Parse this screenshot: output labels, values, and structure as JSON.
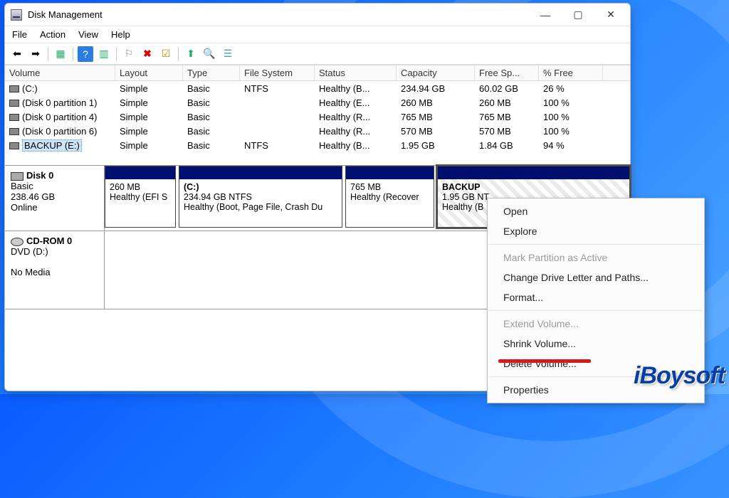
{
  "window": {
    "title": "Disk Management"
  },
  "menu": {
    "file": "File",
    "action": "Action",
    "view": "View",
    "help": "Help"
  },
  "columns": {
    "volume": "Volume",
    "layout": "Layout",
    "type": "Type",
    "filesystem": "File System",
    "status": "Status",
    "capacity": "Capacity",
    "freespace": "Free Sp...",
    "pctfree": "% Free"
  },
  "volumes": [
    {
      "name": "(C:)",
      "layout": "Simple",
      "type": "Basic",
      "fs": "NTFS",
      "status": "Healthy (B...",
      "capacity": "234.94 GB",
      "free": "60.02 GB",
      "pct": "26 %"
    },
    {
      "name": "(Disk 0 partition 1)",
      "layout": "Simple",
      "type": "Basic",
      "fs": "",
      "status": "Healthy (E...",
      "capacity": "260 MB",
      "free": "260 MB",
      "pct": "100 %"
    },
    {
      "name": "(Disk 0 partition 4)",
      "layout": "Simple",
      "type": "Basic",
      "fs": "",
      "status": "Healthy (R...",
      "capacity": "765 MB",
      "free": "765 MB",
      "pct": "100 %"
    },
    {
      "name": "(Disk 0 partition 6)",
      "layout": "Simple",
      "type": "Basic",
      "fs": "",
      "status": "Healthy (R...",
      "capacity": "570 MB",
      "free": "570 MB",
      "pct": "100 %"
    },
    {
      "name": "BACKUP (E:)",
      "layout": "Simple",
      "type": "Basic",
      "fs": "NTFS",
      "status": "Healthy (B...",
      "capacity": "1.95 GB",
      "free": "1.84 GB",
      "pct": "94 %"
    }
  ],
  "disk0": {
    "name": "Disk 0",
    "type": "Basic",
    "size": "238.46 GB",
    "state": "Online",
    "parts": [
      {
        "title": "",
        "line1": "260 MB",
        "line2": "Healthy (EFI S"
      },
      {
        "title": "(C:)",
        "line1": "234.94 GB NTFS",
        "line2": "Healthy (Boot, Page File, Crash Du"
      },
      {
        "title": "",
        "line1": "765 MB",
        "line2": "Healthy (Recover"
      },
      {
        "title": "BACKUP",
        "line1": "1.95 GB NT",
        "line2": "Healthy (B"
      }
    ]
  },
  "cdrom": {
    "name": "CD-ROM 0",
    "type": "DVD (D:)",
    "state": "No Media"
  },
  "context": {
    "open": "Open",
    "explore": "Explore",
    "mark_active": "Mark Partition as Active",
    "change_letter": "Change Drive Letter and Paths...",
    "format": "Format...",
    "extend": "Extend Volume...",
    "shrink": "Shrink Volume...",
    "delete": "Delete Volume...",
    "properties": "Properties"
  },
  "watermark": "iBoysoft"
}
